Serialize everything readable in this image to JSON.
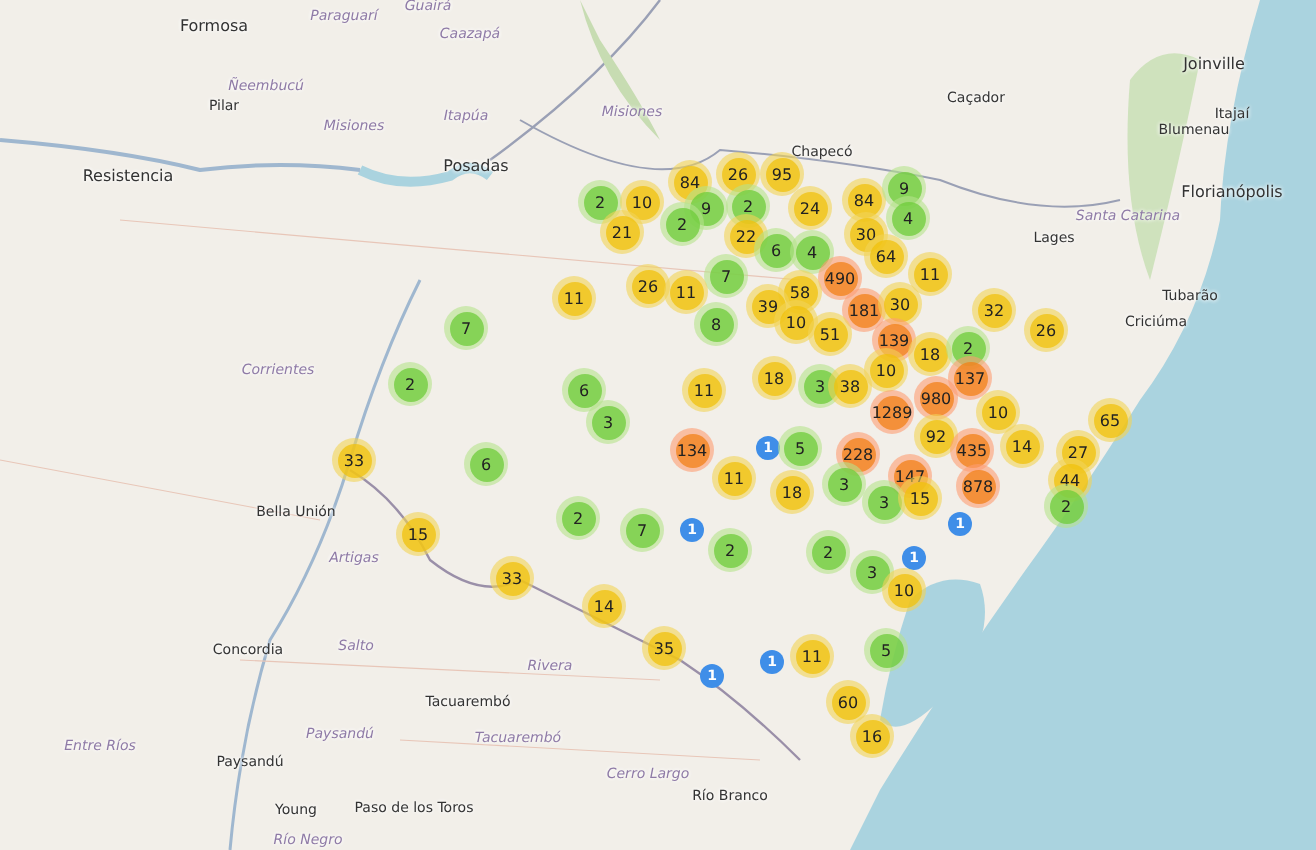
{
  "map": {
    "labels": [
      {
        "text": "Formosa",
        "kind": "city"
      },
      {
        "text": "Paraguarí",
        "kind": "region"
      },
      {
        "text": "Guairá",
        "kind": "region"
      },
      {
        "text": "Caazapá",
        "kind": "region"
      },
      {
        "text": "Ñeembucú",
        "kind": "region"
      },
      {
        "text": "Pilar",
        "kind": "town"
      },
      {
        "text": "Misiones",
        "kind": "region"
      },
      {
        "text": "Itapúa",
        "kind": "region"
      },
      {
        "text": "Posadas",
        "kind": "city"
      },
      {
        "text": "Misiones",
        "kind": "region"
      },
      {
        "text": "Resistencia",
        "kind": "city"
      },
      {
        "text": "Chapecó",
        "kind": "town"
      },
      {
        "text": "Caçador",
        "kind": "town"
      },
      {
        "text": "Joinville",
        "kind": "city"
      },
      {
        "text": "Itajaí",
        "kind": "town"
      },
      {
        "text": "Blumenau",
        "kind": "town"
      },
      {
        "text": "Florianópolis",
        "kind": "city"
      },
      {
        "text": "Santa Catarina",
        "kind": "region"
      },
      {
        "text": "Lages",
        "kind": "town"
      },
      {
        "text": "Tubarão",
        "kind": "town"
      },
      {
        "text": "Criciúma",
        "kind": "town"
      },
      {
        "text": "Corrientes",
        "kind": "region"
      },
      {
        "text": "Bella Unión",
        "kind": "town"
      },
      {
        "text": "Artigas",
        "kind": "region"
      },
      {
        "text": "Concordia",
        "kind": "town"
      },
      {
        "text": "Salto",
        "kind": "region"
      },
      {
        "text": "Rivera",
        "kind": "region"
      },
      {
        "text": "Tacuarembó",
        "kind": "town"
      },
      {
        "text": "Tacuarembó",
        "kind": "region"
      },
      {
        "text": "Entre Ríos",
        "kind": "region"
      },
      {
        "text": "Paysandú",
        "kind": "region"
      },
      {
        "text": "Paysandú",
        "kind": "town"
      },
      {
        "text": "Cerro Largo",
        "kind": "region"
      },
      {
        "text": "Río Branco",
        "kind": "town"
      },
      {
        "text": "Young",
        "kind": "town"
      },
      {
        "text": "Paso de los Toros",
        "kind": "town"
      },
      {
        "text": "Río Negro",
        "kind": "region"
      }
    ],
    "clusters": [
      {
        "count": "2",
        "kind": "small"
      },
      {
        "count": "10",
        "kind": "medium"
      },
      {
        "count": "84",
        "kind": "medium"
      },
      {
        "count": "26",
        "kind": "medium"
      },
      {
        "count": "95",
        "kind": "medium"
      },
      {
        "count": "9",
        "kind": "small"
      },
      {
        "count": "2",
        "kind": "small"
      },
      {
        "count": "2",
        "kind": "small"
      },
      {
        "count": "21",
        "kind": "medium"
      },
      {
        "count": "22",
        "kind": "medium"
      },
      {
        "count": "24",
        "kind": "medium"
      },
      {
        "count": "84",
        "kind": "medium"
      },
      {
        "count": "9",
        "kind": "small"
      },
      {
        "count": "4",
        "kind": "small"
      },
      {
        "count": "30",
        "kind": "medium"
      },
      {
        "count": "64",
        "kind": "medium"
      },
      {
        "count": "6",
        "kind": "small"
      },
      {
        "count": "4",
        "kind": "small"
      },
      {
        "count": "7",
        "kind": "small"
      },
      {
        "count": "490",
        "kind": "large"
      },
      {
        "count": "11",
        "kind": "medium"
      },
      {
        "count": "26",
        "kind": "medium"
      },
      {
        "count": "11",
        "kind": "medium"
      },
      {
        "count": "11",
        "kind": "medium"
      },
      {
        "count": "58",
        "kind": "medium"
      },
      {
        "count": "39",
        "kind": "medium"
      },
      {
        "count": "181",
        "kind": "large"
      },
      {
        "count": "30",
        "kind": "medium"
      },
      {
        "count": "8",
        "kind": "small"
      },
      {
        "count": "10",
        "kind": "medium"
      },
      {
        "count": "51",
        "kind": "medium"
      },
      {
        "count": "32",
        "kind": "medium"
      },
      {
        "count": "26",
        "kind": "medium"
      },
      {
        "count": "139",
        "kind": "large"
      },
      {
        "count": "18",
        "kind": "medium"
      },
      {
        "count": "2",
        "kind": "small"
      },
      {
        "count": "10",
        "kind": "medium"
      },
      {
        "count": "137",
        "kind": "large"
      },
      {
        "count": "3",
        "kind": "small"
      },
      {
        "count": "38",
        "kind": "medium"
      },
      {
        "count": "18",
        "kind": "medium"
      },
      {
        "count": "980",
        "kind": "large"
      },
      {
        "count": "1289",
        "kind": "large"
      },
      {
        "count": "10",
        "kind": "medium"
      },
      {
        "count": "134",
        "kind": "large"
      },
      {
        "count": "1",
        "kind": "single"
      },
      {
        "count": "5",
        "kind": "small"
      },
      {
        "count": "228",
        "kind": "large"
      },
      {
        "count": "92",
        "kind": "medium"
      },
      {
        "count": "435",
        "kind": "large"
      },
      {
        "count": "14",
        "kind": "medium"
      },
      {
        "count": "27",
        "kind": "medium"
      },
      {
        "count": "65",
        "kind": "medium"
      },
      {
        "count": "11",
        "kind": "medium"
      },
      {
        "count": "18",
        "kind": "medium"
      },
      {
        "count": "147",
        "kind": "large"
      },
      {
        "count": "3",
        "kind": "small"
      },
      {
        "count": "878",
        "kind": "large"
      },
      {
        "count": "44",
        "kind": "medium"
      },
      {
        "count": "3",
        "kind": "small"
      },
      {
        "count": "15",
        "kind": "medium"
      },
      {
        "count": "2",
        "kind": "small"
      },
      {
        "count": "1",
        "kind": "single"
      },
      {
        "count": "2",
        "kind": "small"
      },
      {
        "count": "2",
        "kind": "small"
      },
      {
        "count": "3",
        "kind": "small"
      },
      {
        "count": "1",
        "kind": "single"
      },
      {
        "count": "10",
        "kind": "medium"
      },
      {
        "count": "35",
        "kind": "medium"
      },
      {
        "count": "1",
        "kind": "single"
      },
      {
        "count": "1",
        "kind": "single"
      },
      {
        "count": "11",
        "kind": "medium"
      },
      {
        "count": "5",
        "kind": "small"
      },
      {
        "count": "60",
        "kind": "medium"
      },
      {
        "count": "16",
        "kind": "medium"
      },
      {
        "count": "7",
        "kind": "small"
      },
      {
        "count": "2",
        "kind": "small"
      },
      {
        "count": "6",
        "kind": "small"
      },
      {
        "count": "3",
        "kind": "small"
      },
      {
        "count": "11",
        "kind": "medium"
      },
      {
        "count": "33",
        "kind": "medium"
      },
      {
        "count": "6",
        "kind": "small"
      },
      {
        "count": "2",
        "kind": "small"
      },
      {
        "count": "7",
        "kind": "small"
      },
      {
        "count": "1",
        "kind": "single"
      },
      {
        "count": "15",
        "kind": "medium"
      },
      {
        "count": "33",
        "kind": "medium"
      },
      {
        "count": "14",
        "kind": "medium"
      }
    ]
  }
}
